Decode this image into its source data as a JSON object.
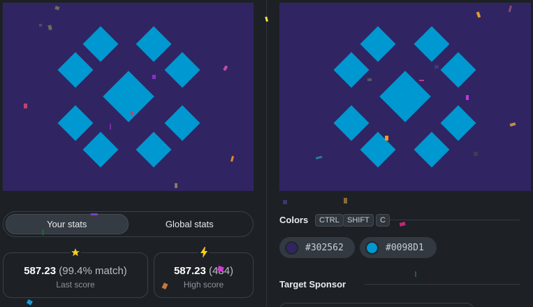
{
  "stats": {
    "tabs": [
      "Your stats",
      "Global stats"
    ],
    "last_score": {
      "value": "587.23",
      "detail": "(99.4% match)",
      "label": "Last score"
    },
    "high_score": {
      "value": "587.23",
      "detail": "(484)",
      "label": "High score"
    }
  },
  "colors_section": {
    "title": "Colors",
    "shortcut_keys": [
      "CTRL",
      "SHIFT",
      "C"
    ],
    "swatches": [
      {
        "hex": "#302562",
        "color": "#302562"
      },
      {
        "hex": "#0098D1",
        "color": "#0098D1"
      }
    ]
  },
  "sponsor_section": {
    "title": "Target Sponsor"
  },
  "theme": {
    "background": "#1d2126",
    "canvas_bg": "#302562",
    "shape_color": "#0098D1",
    "star_icon_color": "#f5cf1a",
    "bolt_icon_color": "#f5cf1a"
  }
}
